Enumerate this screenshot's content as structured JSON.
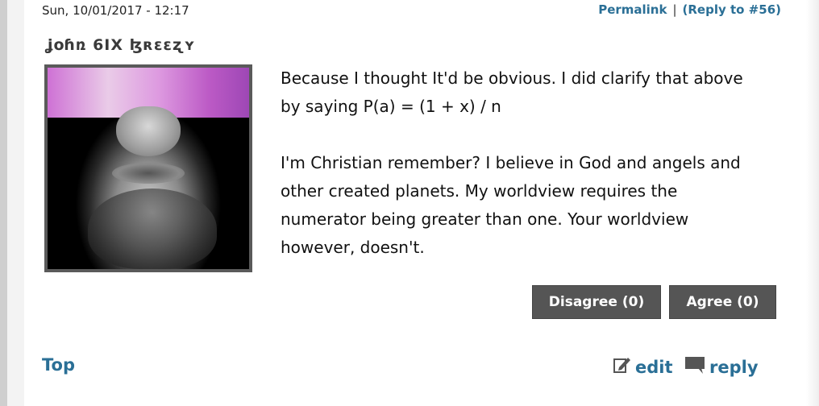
{
  "post": {
    "date": "Sun, 10/01/2017 - 12:17",
    "permalink_label": "Permalink",
    "separator": "|",
    "reply_to_label": "(Reply to #56)",
    "username": "ʝօɦռ 6IX ɮʀɛɛʐʏ",
    "paragraphs": [
      "Because I thought It'd be obvious. I did clarify that above by saying P(a) = (1 + x) / n",
      "I'm Christian remember? I believe in God and angels and other created planets. My worldview requires the numerator being greater than one. Your worldview however, doesn't."
    ],
    "disagree_label": "Disagree (0)",
    "agree_label": "Agree (0)",
    "top_label": "Top",
    "edit_label": "edit",
    "reply_label": "reply"
  },
  "colors": {
    "link": "#2a6f96",
    "button_bg": "#555555",
    "avatar_band": "#e08be6"
  },
  "icons": {
    "edit": "edit-pencil-icon",
    "reply": "speech-bubble-icon"
  }
}
